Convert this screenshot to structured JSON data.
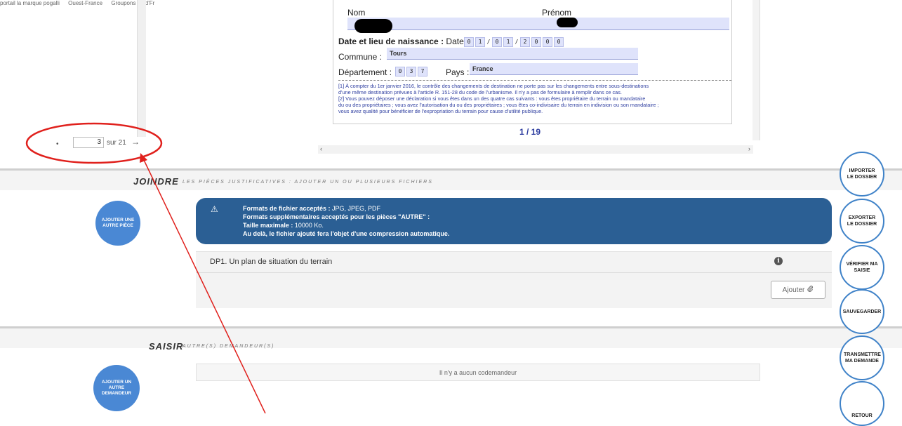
{
  "bookmarks": [
    "portail la marque pogalli",
    "Ouest-France",
    "Groupons Ile-d'Fr"
  ],
  "pdf": {
    "nom_label": "Nom",
    "prenom_label": "Prénom",
    "date_label": "Date et lieu de naissance :",
    "date_sub": "Date :",
    "date_digits": [
      "0",
      "1",
      "/",
      "0",
      "1",
      "/",
      "2",
      "0",
      "0",
      "0"
    ],
    "commune_label": "Commune :",
    "commune_value": "Tours",
    "departement_label": "Département :",
    "departement_digits": [
      "0",
      "3",
      "7"
    ],
    "pays_label": "Pays :",
    "pays_value": "France",
    "note1": "[1] À compter du 1er janvier 2016, le contrôle des changements de destination ne porte pas sur les changements entre sous-destinations",
    "note1b": "d'une même destination prévues à l'article R. 151-28 du code de l'urbanisme. Il n'y a pas de formulaire à remplir dans ce cas.",
    "note2": "[2] Vous pouvez déposer une déclaration si vous êtes dans un des quatre cas suivants : vous êtes propriétaire du terrain ou mandataire",
    "note2b": "du ou des propriétaires ; vous avez l'autorisation du ou des propriétaires ; vous êtes co-indivisaire du terrain en indivision ou son mandataire ;",
    "note2c": "vous avez qualité pour bénéficier de l'expropriation du terrain pour cause d'utilité publique.",
    "page_count": "1 / 19"
  },
  "pager": {
    "current": "3",
    "total_text": "sur 21",
    "next_arrow": "→",
    "prev_dot": "•"
  },
  "joindre": {
    "title": "JOINDRE",
    "subtitle": "LES PIÈCES JUSTIFICATIVES : AJOUTER UN OU PLUSIEURS FICHIERS",
    "add_piece": "AJOUTER UNE AUTRE PIÈCE",
    "banner": {
      "l1_bold": "Formats de fichier acceptés :",
      "l1_rest": " JPG, JPEG, PDF",
      "l2": "Formats supplémentaires acceptés pour les pièces \"AUTRE\" :",
      "l3_bold": "Taille maximale :",
      "l3_rest": " 10000 Ko.",
      "l4": "Au delà, le fichier ajouté fera l'objet d'une compression automatique."
    },
    "doc_title": "DP1. Un plan de situation du terrain",
    "add_button": "Ajouter"
  },
  "saisir": {
    "title": "SAISIR",
    "subtitle": "AUTRE(S) DEMANDEUR(S)",
    "add_demandeur": "AJOUTER UN AUTRE DEMANDEUR",
    "empty_text": "Il n'y a aucun codemandeur"
  },
  "actions": {
    "import": "IMPORTER LE DOSSIER",
    "export": "EXPORTER LE DOSSIER",
    "verify": "VÉRIFIER MA SAISIE",
    "save": "SAUVEGARDER",
    "send": "TRANSMETTRE MA DEMANDE",
    "back": "RETOUR"
  },
  "colors": {
    "banner": "#2b5f94",
    "blue_circle": "#4a88d4",
    "action_border": "#3f82c8",
    "annotation": "#e0201c"
  }
}
